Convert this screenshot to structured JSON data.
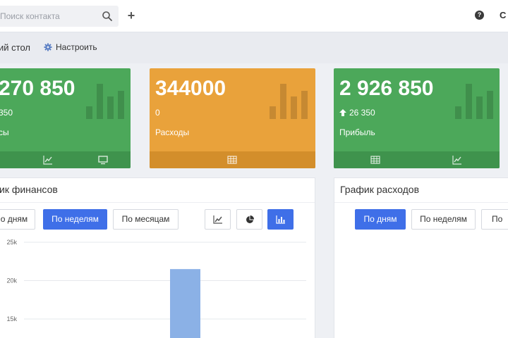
{
  "header": {
    "search_placeholder": "Поиск контакта",
    "top_right_text": "С"
  },
  "subheader": {
    "title": "ий стол",
    "configure_label": "Настроить"
  },
  "cards": [
    {
      "value": "270 850",
      "delta": "350",
      "label": "сы",
      "color": "#4ca85a"
    },
    {
      "value": "344000",
      "delta": "0",
      "label": "Расходы",
      "color": "#e9a23b"
    },
    {
      "value": "2 926 850",
      "delta": "26 350",
      "label": "Прибыль",
      "color": "#4ca85a"
    }
  ],
  "finance_panel": {
    "title": "ик финансов",
    "period_buttons": [
      "о дням",
      "По неделям",
      "По месяцам"
    ],
    "active_period": "По неделям",
    "chart_type_icons": [
      "line-chart-icon",
      "pie-chart-icon",
      "bar-chart-icon"
    ],
    "active_chart_type": "bar-chart-icon"
  },
  "expenses_panel": {
    "title": "График расходов",
    "period_buttons": [
      "По дням",
      "По неделям",
      "По"
    ],
    "active_period": "По дням"
  },
  "colors": {
    "green": "#4ca85a",
    "orange": "#e9a23b",
    "accent": "#3f6fe8",
    "bar": "#8bb1e6"
  },
  "chart_data": {
    "type": "bar",
    "y_ticks": [
      "25k",
      "20k",
      "15k"
    ],
    "ylim": [
      15000,
      25000
    ],
    "bars": [
      {
        "value": 21500
      }
    ]
  }
}
